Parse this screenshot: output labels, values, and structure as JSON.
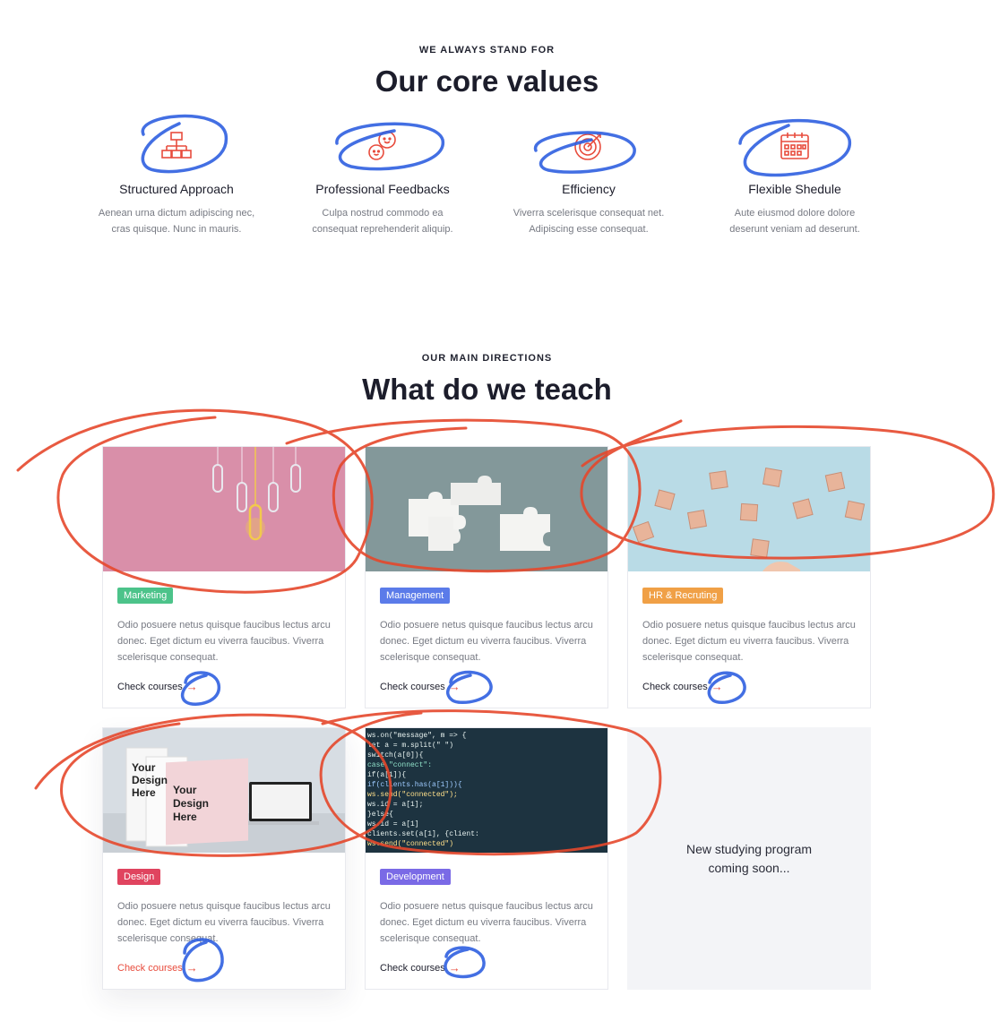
{
  "core_values": {
    "eyebrow": "WE ALWAYS STAND FOR",
    "title": "Our core values",
    "items": [
      {
        "icon": "hierarchy-icon",
        "title": "Structured Approach",
        "desc": "Aenean urna dictum adipiscing nec, cras quisque. Nunc in mauris."
      },
      {
        "icon": "chat-feedback-icon",
        "title": "Professional Feedbacks",
        "desc": "Culpa nostrud commodo ea consequat reprehenderit aliquip."
      },
      {
        "icon": "target-icon",
        "title": "Efficiency",
        "desc": "Viverra scelerisque consequat net. Adipiscing esse consequat."
      },
      {
        "icon": "calendar-icon",
        "title": "Flexible Shedule",
        "desc": "Aute eiusmod dolore dolore deserunt veniam ad deserunt."
      }
    ],
    "accent_color": "#e84c3d"
  },
  "directions": {
    "eyebrow": "OUR MAIN DIRECTIONS",
    "title": "What do we teach",
    "cards": [
      {
        "tag": "Marketing",
        "tag_color": "#4cc38a",
        "desc": "Odio posuere netus quisque faucibus lectus arcu donec. Eget dictum eu viverra faucibus. Viverra scelerisque consequat.",
        "link": "Check courses",
        "image": "paperclips-lightbulb"
      },
      {
        "tag": "Management",
        "tag_color": "#5b7be9",
        "desc": "Odio posuere netus quisque faucibus lectus arcu donec. Eget dictum eu viverra faucibus. Viverra scelerisque consequat.",
        "link": "Check courses",
        "image": "puzzle-pieces"
      },
      {
        "tag": "HR & Recruting",
        "tag_color": "#f0a046",
        "desc": "Odio posuere netus quisque faucibus lectus arcu donec. Eget dictum eu viverra faucibus. Viverra scelerisque consequat.",
        "link": "Check courses",
        "image": "people-blocks"
      },
      {
        "tag": "Design",
        "tag_color": "#e0445f",
        "desc": "Odio posuere netus quisque faucibus lectus arcu donec. Eget dictum eu viverra faucibus. Viverra scelerisque consequat.",
        "link": "Check courses",
        "image": "design-mockups"
      },
      {
        "tag": "Development",
        "tag_color": "#7a6ae6",
        "desc": "Odio posuere netus quisque faucibus lectus arcu donec. Eget dictum eu viverra faucibus. Viverra scelerisque consequat.",
        "link": "Check courses",
        "image": "code-screen"
      }
    ],
    "coming_soon": "New studying program coming soon..."
  },
  "thumbnail_text": {
    "design_mock_lines": [
      "Your",
      "Design",
      "Here"
    ],
    "code_lines": [
      "ws.on(\"message\", m => {",
      "  let a = m.split(\" \")",
      "  switch(a[0]){",
      "    case \"connect\":",
      "      if(a[1]){",
      "        if(clients.has(a[1])){",
      "          ws.send(\"connected\");",
      "          ws.id = a[1];",
      "        }else{",
      "          ws.id = a[1]",
      "          clients.set(a[1], {client:",
      "          ws.send(\"connected\")"
    ]
  },
  "annotation_colors": {
    "blue": "#2f5fe0",
    "red": "#e5482c"
  }
}
